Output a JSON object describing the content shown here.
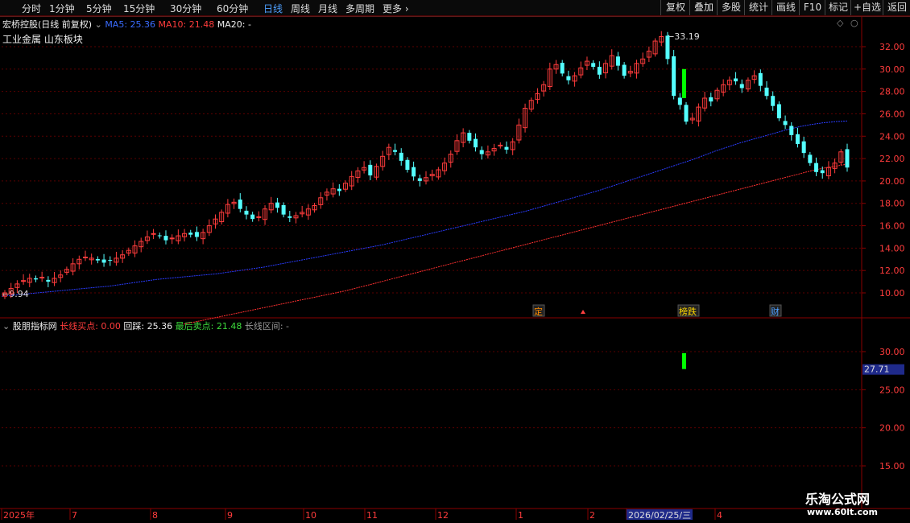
{
  "periods": [
    "分时",
    "1分钟",
    "5分钟",
    "15分钟",
    "30分钟",
    "60分钟",
    "日线",
    "周线",
    "月线",
    "多周期",
    "更多"
  ],
  "active_period": "日线",
  "toolbar": [
    "复权",
    "叠加",
    "多股",
    "统计",
    "画线",
    "F10",
    "标记",
    "+自选",
    "返回"
  ],
  "stock": {
    "title": "宏桥控股(日线 前复权)",
    "ma5": "MA5: 25.36",
    "ma10": "MA10: 21.48",
    "ma20": "MA20: -",
    "sectors": "工业金属  山东板块"
  },
  "price_axis": [
    "32.00",
    "30.00",
    "28.00",
    "26.00",
    "24.00",
    "22.00",
    "20.00",
    "18.00",
    "16.00",
    "14.00",
    "12.00",
    "10.00"
  ],
  "high_label": "33.19",
  "low_label": "9.94",
  "events": [
    {
      "text": "定",
      "color": "#ff8c00"
    },
    {
      "text": "榜跌",
      "color": "#ffd700"
    },
    {
      "text": "财",
      "color": "#4ea0ff"
    }
  ],
  "indicator": {
    "name": "股朋指标网",
    "buy": "长线买点: 0.00",
    "huicai": "回踩: 25.36",
    "sell": "最后卖点: 21.48",
    "range": "长线区间: -",
    "axis": [
      "30.00",
      "25.00",
      "20.00",
      "15.00"
    ],
    "current": "27.71"
  },
  "date_axis": [
    "2025年",
    "7",
    "8",
    "9",
    "10",
    "11",
    "12",
    "1",
    "2",
    "2026/02/25/三",
    "4"
  ],
  "watermark": {
    "title": "乐淘公式网",
    "url": "www.60lt.com"
  },
  "colors": {
    "up": "#ff3c3c",
    "down": "#54ffff",
    "ma5": "#2a3cff",
    "ma10": "#ff3030",
    "grid": "#5a0000",
    "bigbar": "#00ff00"
  },
  "chart_data": {
    "type": "candlestick",
    "title": "宏桥控股(日线 前复权)",
    "ylim": [
      9,
      33.5
    ],
    "close": [
      10.0,
      10.4,
      10.8,
      11.1,
      11.3,
      11.2,
      11.4,
      11.0,
      11.3,
      11.6,
      12.1,
      12.6,
      13.0,
      13.2,
      13.1,
      12.9,
      12.7,
      12.9,
      13.1,
      13.4,
      13.8,
      14.2,
      14.6,
      15.0,
      15.3,
      15.1,
      14.7,
      14.9,
      15.1,
      15.3,
      15.2,
      15.0,
      15.4,
      16.0,
      16.6,
      17.2,
      17.9,
      18.1,
      17.5,
      17.0,
      16.6,
      16.8,
      17.5,
      18.0,
      17.6,
      17.0,
      16.7,
      16.9,
      17.2,
      17.5,
      17.8,
      18.5,
      19.0,
      19.3,
      19.1,
      19.8,
      20.4,
      20.9,
      21.2,
      20.5,
      21.3,
      22.2,
      23.0,
      22.6,
      21.8,
      21.0,
      20.4,
      20.0,
      20.3,
      20.6,
      21.0,
      21.6,
      22.4,
      23.6,
      24.3,
      23.6,
      23.0,
      22.4,
      22.6,
      22.9,
      23.2,
      22.8,
      23.5,
      25.0,
      26.5,
      27.2,
      27.8,
      28.6,
      30.0,
      30.4,
      29.6,
      29.0,
      29.4,
      30.1,
      30.7,
      30.2,
      29.5,
      30.5,
      31.2,
      30.3,
      29.4,
      29.8,
      30.5,
      30.9,
      31.6,
      32.5,
      32.9,
      30.9,
      27.6,
      26.8,
      25.3,
      25.6,
      26.6,
      27.4,
      27.1,
      28.1,
      28.6,
      29.0,
      28.9,
      28.3,
      29.0,
      29.4,
      28.5,
      27.6,
      26.7,
      25.6,
      25.0,
      24.1,
      23.3,
      22.5,
      21.6,
      20.8,
      20.7,
      21.2,
      21.6,
      22.6,
      21.2
    ],
    "ma5": [
      9.7,
      9.8,
      9.9,
      10.0,
      10.1,
      10.2,
      10.3,
      10.4,
      10.5,
      10.6,
      10.75,
      10.9,
      11.05,
      11.2,
      11.3,
      11.4,
      11.5,
      11.6,
      11.7,
      11.85,
      12.0,
      12.15,
      12.3,
      12.5,
      12.7,
      12.9,
      13.1,
      13.3,
      13.5,
      13.7,
      13.9,
      14.1,
      14.3,
      14.55,
      14.8,
      15.05,
      15.3,
      15.55,
      15.8,
      16.05,
      16.3,
      16.55,
      16.8,
      17.05,
      17.3,
      17.6,
      17.9,
      18.2,
      18.5,
      18.8,
      19.1,
      19.45,
      19.8,
      20.15,
      20.5,
      20.85,
      21.2,
      21.55,
      21.9,
      22.3,
      22.7,
      23.05,
      23.4,
      23.7,
      24.0,
      24.3,
      24.6,
      24.85,
      25.05,
      25.2,
      25.3,
      25.36
    ],
    "ma10": [
      7.2,
      7.4,
      7.6,
      7.8,
      8.0,
      8.2,
      8.4,
      8.6,
      8.8,
      9.0,
      9.2,
      9.4,
      9.6,
      9.8,
      10.0,
      10.2,
      10.45,
      10.7,
      10.95,
      11.2,
      11.45,
      11.7,
      11.95,
      12.2,
      12.45,
      12.7,
      12.95,
      13.2,
      13.45,
      13.7,
      13.95,
      14.2,
      14.45,
      14.7,
      14.95,
      15.2,
      15.45,
      15.7,
      15.95,
      16.2,
      16.45,
      16.7,
      16.95,
      17.2,
      17.45,
      17.7,
      17.95,
      18.2,
      18.45,
      18.7,
      18.95,
      19.2,
      19.45,
      19.7,
      19.95,
      20.2,
      20.45,
      20.7,
      20.95,
      21.15,
      21.3,
      21.48
    ],
    "indicator_bar": {
      "from": 27.71,
      "to": 29.8,
      "index": 108
    }
  }
}
